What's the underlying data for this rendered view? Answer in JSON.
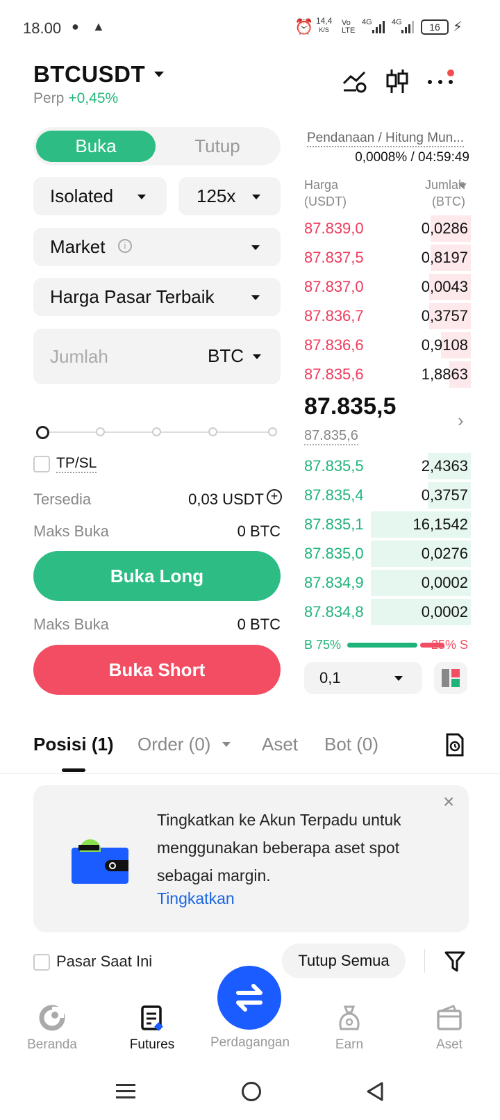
{
  "status_bar": {
    "time": "18.00",
    "speed": "14,4",
    "speed_unit": "K/S",
    "volte": "Vo LTE",
    "net1": "4G",
    "net2": "4G",
    "battery": "16"
  },
  "header": {
    "symbol": "BTCUSDT",
    "type": "Perp",
    "change": "+0,45%"
  },
  "order_form": {
    "tab_open": "Buka",
    "tab_close": "Tutup",
    "margin_mode": "Isolated",
    "leverage": "125x",
    "order_type": "Market",
    "price_mode": "Harga Pasar Terbaik",
    "qty_placeholder": "Jumlah",
    "qty_unit": "BTC",
    "slider_percent": 0,
    "tpsl_label": "TP/SL",
    "available_label": "Tersedia",
    "available_value": "0,03 USDT",
    "max_open_label": "Maks Buka",
    "max_open_long": "0 BTC",
    "long_button": "Buka Long",
    "max_open_label_2": "Maks Buka",
    "max_open_short": "0 BTC",
    "short_button": "Buka Short"
  },
  "orderbook": {
    "funding_label": "Pendanaan / Hitung Mun...",
    "funding_value": "0,0008% / 04:59:49",
    "col_price": "Harga",
    "col_price_unit": "(USDT)",
    "col_qty": "Jumlah",
    "col_qty_unit": "(BTC)",
    "asks": [
      {
        "price": "87.839,0",
        "qty": "0,0286",
        "depth": 0.24
      },
      {
        "price": "87.837,5",
        "qty": "0,8197",
        "depth": 0.24
      },
      {
        "price": "87.837,0",
        "qty": "0,0043",
        "depth": 0.25
      },
      {
        "price": "87.836,7",
        "qty": "0,3757",
        "depth": 0.25
      },
      {
        "price": "87.836,6",
        "qty": "0,9108",
        "depth": 0.18
      },
      {
        "price": "87.835,6",
        "qty": "1,8863",
        "depth": 0.13
      }
    ],
    "last_price": "87.835,5",
    "mark_price": "87.835,6",
    "bids": [
      {
        "price": "87.835,5",
        "qty": "2,4363",
        "depth": 0.26
      },
      {
        "price": "87.835,4",
        "qty": "0,3757",
        "depth": 0.26
      },
      {
        "price": "87.835,1",
        "qty": "16,1542",
        "depth": 0.6
      },
      {
        "price": "87.835,0",
        "qty": "0,0276",
        "depth": 0.6
      },
      {
        "price": "87.834,9",
        "qty": "0,0002",
        "depth": 0.6
      },
      {
        "price": "87.834,8",
        "qty": "0,0002",
        "depth": 0.6
      }
    ],
    "buy_ratio_label": "B 75%",
    "sell_ratio_label": "25% S",
    "buy_ratio": 0.75,
    "precision": "0,1"
  },
  "positions_tabs": {
    "positions": "Posisi (1)",
    "orders": "Order (0)",
    "assets": "Aset",
    "bots": "Bot (0)"
  },
  "banner": {
    "text": "Tingkatkan ke Akun Terpadu untuk menggunakan beberapa aset spot sebagai margin.",
    "link": "Tingkatkan"
  },
  "filter_row": {
    "current_market": "Pasar Saat Ini",
    "close_all": "Tutup Semua"
  },
  "bottom_nav": {
    "home": "Beranda",
    "futures": "Futures",
    "trade": "Perdagangan",
    "earn": "Earn",
    "assets": "Aset"
  },
  "colors": {
    "green": "#2dbd84",
    "red": "#f24d62",
    "blue": "#1a5cff"
  }
}
